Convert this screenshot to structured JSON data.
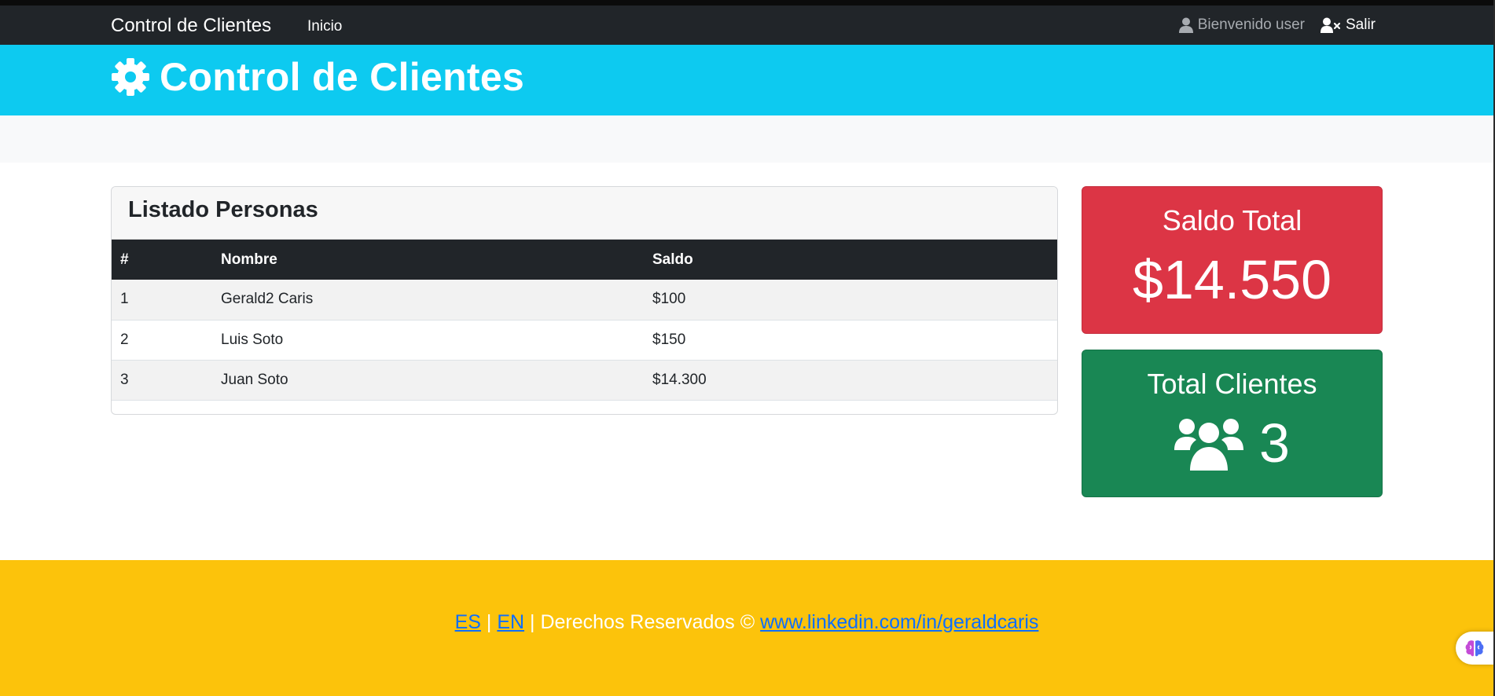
{
  "navbar": {
    "brand": "Control de Clientes",
    "link_home": "Inicio",
    "welcome": "Bienvenido user",
    "logout": "Salir"
  },
  "header": {
    "title": "Control de Clientes",
    "icon": "gear-icon"
  },
  "list": {
    "title": "Listado Personas",
    "columns": [
      "#",
      "Nombre",
      "Saldo"
    ],
    "rows": [
      {
        "id": "1",
        "name": "Gerald2 Caris",
        "balance": "$100"
      },
      {
        "id": "2",
        "name": "Luis Soto",
        "balance": "$150"
      },
      {
        "id": "3",
        "name": "Juan Soto",
        "balance": "$14.300"
      }
    ]
  },
  "stats": {
    "balance_title": "Saldo Total",
    "balance_value": "$14.550",
    "clients_title": "Total Clientes",
    "clients_value": "3",
    "clients_icon": "users-icon"
  },
  "footer": {
    "lang_es": "ES",
    "sep1": "|",
    "lang_en": "EN",
    "rights": "| Derechos Reservados ©",
    "link": "www.linkedin.com/in/geraldcaris"
  },
  "colors": {
    "navbar": "#212529",
    "header": "#0dcaf0",
    "balance_card": "#dc3545",
    "clients_card": "#198754",
    "footer": "#fcc30b",
    "link": "#0d6efd"
  }
}
